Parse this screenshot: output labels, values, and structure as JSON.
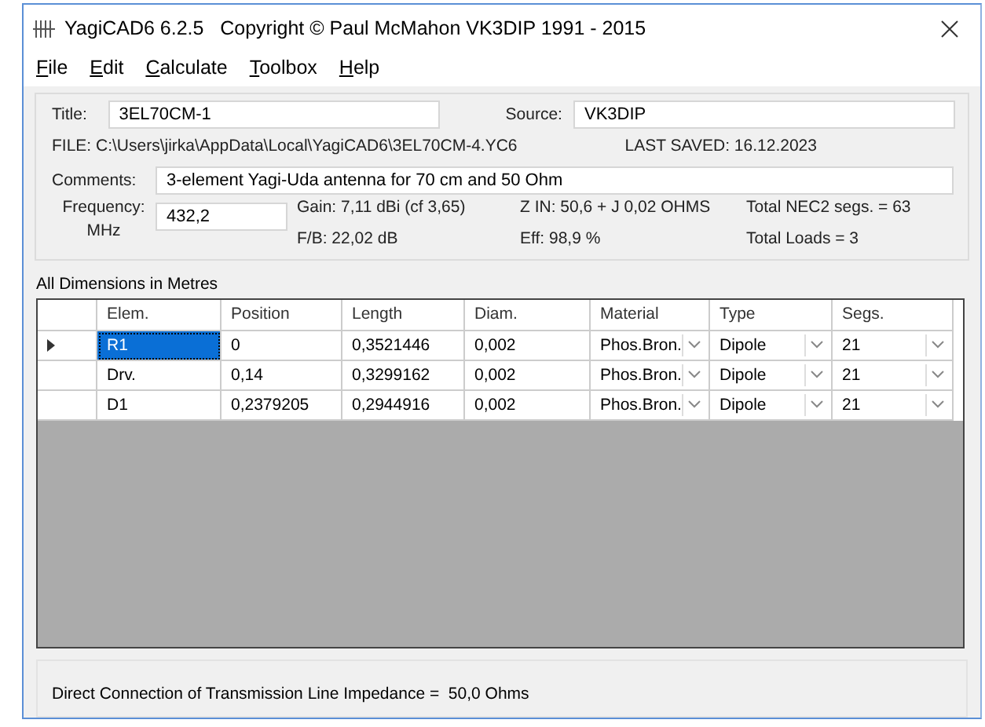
{
  "window": {
    "title": "YagiCAD6 6.2.5   Copyright © Paul McMahon VK3DIP 1991 - 2015"
  },
  "menu": [
    "File",
    "Edit",
    "Calculate",
    "Toolbox",
    "Help"
  ],
  "info": {
    "title_label": "Title:",
    "title_value": "3EL70CM-1",
    "source_label": "Source:",
    "source_value": "VK3DIP",
    "file": "FILE: C:\\Users\\jirka\\AppData\\Local\\YagiCAD6\\3EL70CM-4.YC6",
    "last_saved": "LAST SAVED: 16.12.2023",
    "comments_label": "Comments:",
    "comments_value": "3-element Yagi-Uda antenna for 70 cm and 50 Ohm",
    "frequency_label": "Frequency:",
    "frequency_unit": "MHz",
    "frequency_value": "432,2",
    "gain": "Gain: 7,11 dBi (cf 3,65)",
    "fb": "F/B: 22,02 dB",
    "zin": "Z IN: 50,6 + J 0,02 OHMS",
    "eff": "Eff: 98,9 %",
    "nec_segs": "Total NEC2 segs. = 63",
    "loads": "Total Loads = 3"
  },
  "grid_caption": "All Dimensions in Metres",
  "table": {
    "columns": [
      "Elem.",
      "Position",
      "Length",
      "Diam.",
      "Material",
      "Type",
      "Segs."
    ],
    "rows": [
      {
        "selected": true,
        "cells": [
          "R1",
          "0",
          "0,3521446",
          "0,002",
          "Phos.Bron.",
          "Dipole",
          "21"
        ]
      },
      {
        "selected": false,
        "cells": [
          "Drv.",
          "0,14",
          "0,3299162",
          "0,002",
          "Phos.Bron.",
          "Dipole",
          "21"
        ]
      },
      {
        "selected": false,
        "cells": [
          "D1",
          "0,2379205",
          "0,2944916",
          "0,002",
          "Phos.Bron.",
          "Dipole",
          "21"
        ]
      }
    ]
  },
  "status": "Direct Connection of Transmission Line Impedance =  50,0 Ohms"
}
